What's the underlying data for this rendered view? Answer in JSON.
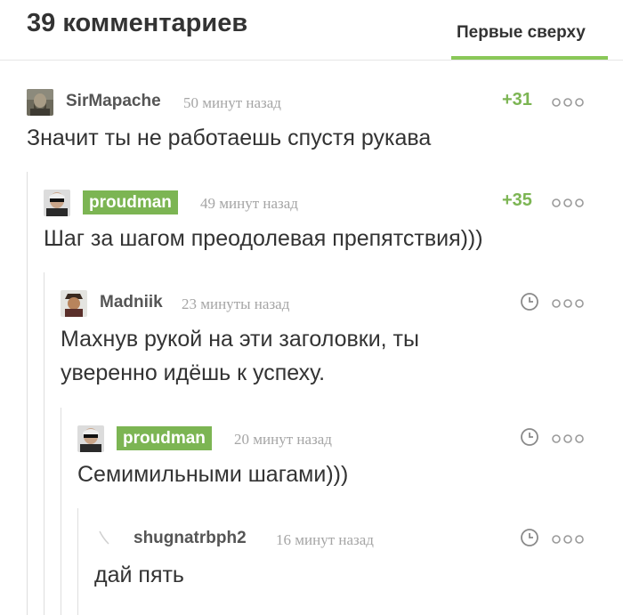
{
  "header": {
    "count_title": "39 комментариев",
    "sort_label": "Первые сверху"
  },
  "colors": {
    "accent": "#8ac858",
    "op_badge": "#7cb553",
    "rating": "#7cb553",
    "timestamp": "#a5a5a5",
    "branch_line": "#dedede"
  },
  "comments": [
    {
      "author": "SirMapache",
      "time": "50 минут назад",
      "rating": "+31",
      "text_lines": [
        "Значит ты не работаешь спустя рукава"
      ],
      "is_op": false,
      "avatar_icon": "bearded-portrait-avatar"
    },
    {
      "author": "proudman",
      "time": "49 минут назад",
      "rating": "+35",
      "text_lines": [
        "Шаг за шагом преодолевая препятствия)))"
      ],
      "is_op": true,
      "avatar_icon": "sunglasses-man-avatar"
    },
    {
      "author": "Madniik",
      "time": "23 минуты назад",
      "rating": "",
      "text_lines": [
        "Махнув рукой на эти заголовки, ты",
        "уверенно идёшь к успеху."
      ],
      "is_op": false,
      "avatar_icon": "hat-man-avatar"
    },
    {
      "author": "proudman",
      "time": "20 минут назад",
      "rating": "",
      "text_lines": [
        "Семимильными шагами)))"
      ],
      "is_op": true,
      "avatar_icon": "sunglasses-man-avatar"
    },
    {
      "author": "shugnatrbph2",
      "time": "16 минут назад",
      "rating": "",
      "text_lines": [
        "дай пять"
      ],
      "is_op": false,
      "avatar_icon": "placeholder-avatar"
    }
  ]
}
